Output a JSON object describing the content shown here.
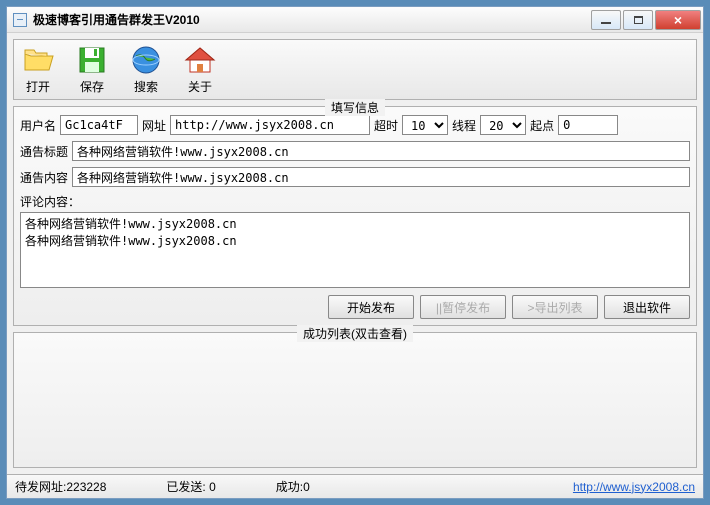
{
  "titlebar": {
    "title": "极速博客引用通告群发王V2010"
  },
  "toolbar": {
    "open": "打开",
    "save": "保存",
    "search": "搜索",
    "about": "关于"
  },
  "form": {
    "group_title": "填写信息",
    "username_label": "用户名",
    "username_value": "Gc1ca4tF",
    "url_label": "网址",
    "url_value": "http://www.jsyx2008.cn",
    "timeout_label": "超时",
    "timeout_value": "10",
    "threads_label": "线程",
    "threads_value": "20",
    "start_label": "起点",
    "start_value": "0",
    "title_label": "通告标题",
    "title_value": "各种网络营销软件!www.jsyx2008.cn",
    "content_label": "通告内容",
    "content_value": "各种网络营销软件!www.jsyx2008.cn",
    "comment_label": "评论内容：",
    "comment_value": "各种网络营销软件!www.jsyx2008.cn\n各种网络营销软件!www.jsyx2008.cn"
  },
  "buttons": {
    "start": "开始发布",
    "pause": "||暂停发布",
    "export": ">导出列表",
    "exit": "退出软件"
  },
  "success_group_title": "成功列表(双击查看)",
  "status": {
    "pending_label": "待发网址:",
    "pending_value": "223228",
    "sent_label": "已发送:",
    "sent_value": "0",
    "ok_label": "成功:",
    "ok_value": "0",
    "link": "http://www.jsyx2008.cn"
  }
}
